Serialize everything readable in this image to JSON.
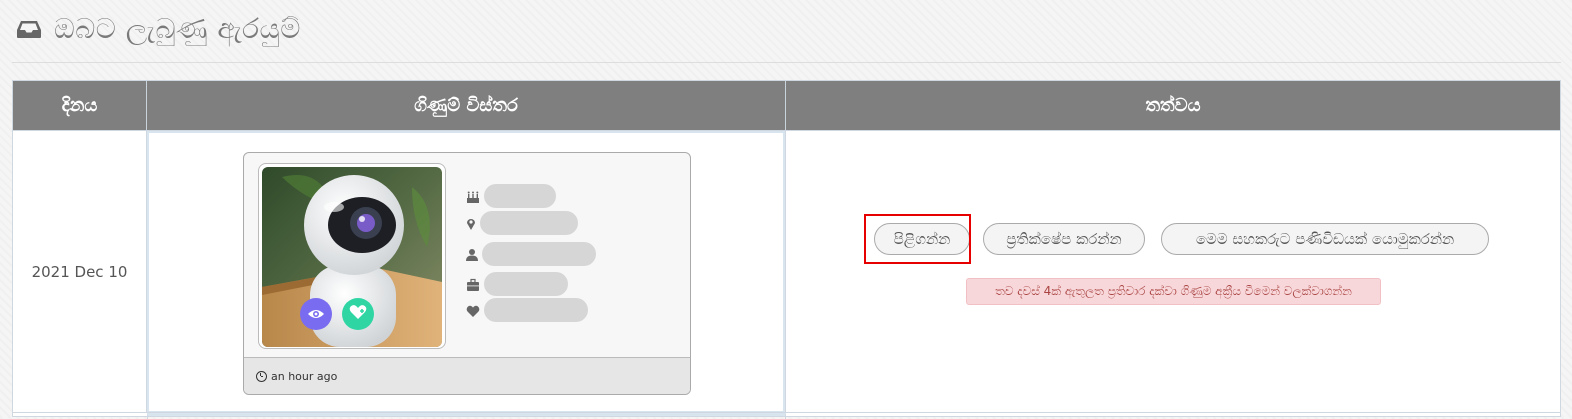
{
  "page": {
    "title": "ඔබට ලැබුණු ඇරයුම්",
    "title_icon": "inbox-icon"
  },
  "table": {
    "headers": {
      "date": "දිනය",
      "details": "ගිණුම් විස්තර",
      "status": "තත්වය"
    },
    "rows": [
      {
        "date": "2021 Dec 10",
        "card": {
          "photo": "white security camera on wooden table",
          "info_icons": [
            "birthday-cake-icon",
            "location-pin-icon",
            "user-icon",
            "briefcase-icon",
            "heart-icon"
          ],
          "overlay_buttons": [
            "eye-icon",
            "heart-plus-icon"
          ],
          "footer_time": "an hour ago"
        },
        "actions": {
          "accept_label": "පිළිගන්න",
          "reject_label": "ප්‍රතික්ෂේප කරන්න",
          "report_label": "මෙම සහකරුට පණිවිඩයක් යොමුකරන්න"
        },
        "notice": "තව දවස් 4ක් ඇතුලත ප්‍රතිචාර දක්වා ගිණුම අක්‍රීය වීමෙන් වලක්වාගන්න"
      }
    ]
  },
  "colors": {
    "header_bg": "#7f7f7f",
    "highlight": "#e60000",
    "notice_bg": "#f8d7da",
    "notice_text": "#a94442",
    "view_button": "#7a6cf0",
    "like_button": "#2fd6a4"
  }
}
